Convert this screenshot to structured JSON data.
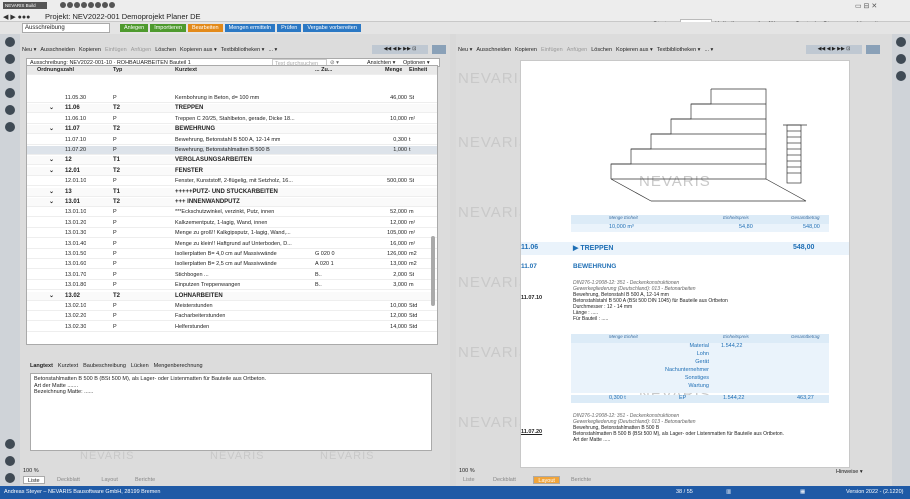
{
  "app": {
    "badge": "NEVARIS Build",
    "title": "Projekt: NEV2022-001 Demoprojekt Planer DE"
  },
  "nav_tabs": [
    "Starten",
    "Planen",
    "Kalkulieren",
    "Ausführen",
    "Control",
    "Steuern",
    "Verwalten"
  ],
  "active_nav": "Planen",
  "ribbon": {
    "left_label": "Ausschreibung",
    "actions": [
      {
        "label": "Anlegen",
        "color": "#4e9a2e"
      },
      {
        "label": "Importieren",
        "color": "#4e9a2e"
      },
      {
        "label": "Bearbeiten",
        "color": "#e38a1a"
      },
      {
        "label": "Mengen ermitteln",
        "color": "#2b78c4"
      },
      {
        "label": "Prüfen",
        "color": "#2b78c4"
      },
      {
        "label": "Vergabe vorbereiten",
        "color": "#2b78c4"
      }
    ]
  },
  "left_toolbar": [
    "Neu ▾",
    "Ausschneiden",
    "Kopieren",
    "Einfügen",
    "Anfügen",
    "Löschen",
    "Kopieren aus ▾",
    "Textbibliotheken ▾",
    "... ▾"
  ],
  "left_toolbar_disabled": [
    "Einfügen",
    "Anfügen"
  ],
  "grid": {
    "title": "Ausschreibung: NEV2022-001-10 · ROHBAUARBEITEN Bauteil 1",
    "filter_placeholder": "Text durchsuchen",
    "views": "Ansichten ▾",
    "options": "Optionen ▾",
    "headers": [
      "Ordnungszahl",
      "Typ",
      "Kurztext",
      "... Zu...",
      "Menge",
      "Einheit"
    ],
    "rows": [
      {
        "oz": "11.05.30",
        "typ": "P",
        "text": "Kernbohrung in Beton, d= 100 mm",
        "zu": "",
        "menge": "46,000",
        "einheit": "St",
        "level": "pos"
      },
      {
        "oz": "11.06",
        "typ": "T2",
        "text": "TREPPEN",
        "zu": "",
        "menge": "",
        "einheit": "",
        "level": "t2"
      },
      {
        "oz": "11.06.10",
        "typ": "P",
        "text": "Treppen C 20/25, Stahlbeton, gerade, Dicke 18...",
        "zu": "",
        "menge": "10,000",
        "einheit": "m³",
        "level": "pos"
      },
      {
        "oz": "11.07",
        "typ": "T2",
        "text": "BEWEHRUNG",
        "zu": "",
        "menge": "",
        "einheit": "",
        "level": "t2"
      },
      {
        "oz": "11.07.10",
        "typ": "P",
        "text": "Bewehrung, Betonstahl B 500 A, 12-14 mm",
        "zu": "",
        "menge": "0,300",
        "einheit": "t",
        "level": "pos"
      },
      {
        "oz": "11.07.20",
        "typ": "P",
        "text": "Bewehrung, Betonstahlmatten B 500 B",
        "zu": "",
        "menge": "1,000",
        "einheit": "t",
        "level": "sel"
      },
      {
        "oz": "12",
        "typ": "T1",
        "text": "VERGLASUNGSARBEITEN",
        "zu": "",
        "menge": "",
        "einheit": "",
        "level": "t1"
      },
      {
        "oz": "12.01",
        "typ": "T2",
        "text": "FENSTER",
        "zu": "",
        "menge": "",
        "einheit": "",
        "level": "t2"
      },
      {
        "oz": "12.01.10",
        "typ": "P",
        "text": "Fenster, Kunststoff, 2-flügelig, mit Setzholz, 16...",
        "zu": "",
        "menge": "500,000",
        "einheit": "St",
        "level": "pos"
      },
      {
        "oz": "13",
        "typ": "T1",
        "text": "+++++PUTZ- UND STUCKARBEITEN",
        "zu": "",
        "menge": "",
        "einheit": "",
        "level": "t1"
      },
      {
        "oz": "13.01",
        "typ": "T2",
        "text": "+++ INNENWANDPUTZ",
        "zu": "",
        "menge": "",
        "einheit": "",
        "level": "t2"
      },
      {
        "oz": "13.01.10",
        "typ": "P",
        "text": "***Eckschutzwinkel, verzinkt, Putz, innen",
        "zu": "",
        "menge": "52,000",
        "einheit": "m",
        "level": "pos"
      },
      {
        "oz": "13.01.20",
        "typ": "P",
        "text": "Kalkzementputz, 1-lagig, Wand, innen",
        "zu": "",
        "menge": "12,000",
        "einheit": "m²",
        "level": "pos"
      },
      {
        "oz": "13.01.30",
        "typ": "P",
        "text": "Menge zu groß!! Kalkgipsputz, 1-lagig, Wand,...",
        "zu": "",
        "menge": "105,000",
        "einheit": "m²",
        "level": "pos"
      },
      {
        "oz": "13.01.40",
        "typ": "P",
        "text": "Menge zu klein!! Haftgrund auf Unterboden, D...",
        "zu": "",
        "menge": "16,000",
        "einheit": "m²",
        "level": "pos"
      },
      {
        "oz": "13.01.50",
        "typ": "P",
        "text": "Isolierplatten B= 4,0 cm auf Massivwände",
        "zu": "G 020 0",
        "menge": "126,000",
        "einheit": "m2",
        "level": "pos"
      },
      {
        "oz": "13.01.60",
        "typ": "P",
        "text": "Isolierplatten B= 2,5 cm auf Massivwände",
        "zu": "A 020 1",
        "menge": "13,000",
        "einheit": "m2",
        "level": "pos"
      },
      {
        "oz": "13.01.70",
        "typ": "P",
        "text": "Stichbogen ...",
        "zu": "B..",
        "menge": "2,000",
        "einheit": "St",
        "level": "pos"
      },
      {
        "oz": "13.01.80",
        "typ": "P",
        "text": "Einputzen Treppenwangen",
        "zu": "B..",
        "menge": "3,000",
        "einheit": "m",
        "level": "pos"
      },
      {
        "oz": "13.02",
        "typ": "T2",
        "text": "LOHNARBEITEN",
        "zu": "",
        "menge": "",
        "einheit": "",
        "level": "t2"
      },
      {
        "oz": "13.02.10",
        "typ": "P",
        "text": "Meisterstunden",
        "zu": "",
        "menge": "10,000",
        "einheit": "Std",
        "level": "pos"
      },
      {
        "oz": "13.02.20",
        "typ": "P",
        "text": "Facharbeiterstunden",
        "zu": "",
        "menge": "12,000",
        "einheit": "Std",
        "level": "pos"
      },
      {
        "oz": "13.02.30",
        "typ": "P",
        "text": "Helferstunden",
        "zu": "",
        "menge": "14,000",
        "einheit": "Std",
        "level": "pos"
      }
    ]
  },
  "detail_tabs": [
    "Langtext",
    "Kurztext",
    "Baubeschreibung",
    "Lücken",
    "Mengenberechnung"
  ],
  "detail_lines": [
    "Betonstahlmatten B 500 B (BSt 500 M), als Lager- oder Listenmatten für Bauteile aus Ortbeton.",
    "Art der Matte .......",
    "Bezeichnung Matte: ......"
  ],
  "left_bottom": {
    "zoom": "100 %",
    "tabs": [
      "Liste",
      "Deckblatt",
      "Layout",
      "Berichte"
    ],
    "active": "Liste"
  },
  "right_toolbar": [
    "Neu ▾",
    "Ausschneiden",
    "Kopieren",
    "Einfügen",
    "Anfügen",
    "Löschen",
    "Kopieren aus ▾",
    "Textbibliotheken ▾",
    "... ▾"
  ],
  "preview": {
    "watermark": "NEVARIS",
    "price_head": [
      "Menge Einheit",
      "Einheitspreis",
      "Gesamtbetrag"
    ],
    "price_row": [
      "10,000 m³",
      "54,80",
      "548,00"
    ],
    "treppen": {
      "oz": "11.06",
      "title": "▶ TREPPEN",
      "total": "548,00"
    },
    "bewehrung": {
      "oz": "11.07",
      "title": "BEWEHRUNG"
    },
    "pos1": {
      "oz": "11.07.10",
      "norm": "DIN276-1:2008-12: 351 - Deckenkonstruktionen",
      "gewerk": "Gewerkegliederung (Deutschland): 013 - Betonarbeiten",
      "lines": [
        "Bewehrung, Betonstahl B 500 A, 12-14 mm",
        "Betonstahlstahl B 500 A (BSt 500 DIN 1045) für Bauteile aus Ortbeton",
        "Durchmesser : 12 - 14 mm",
        "Länge : .....",
        "Für Bauteil : ....."
      ]
    },
    "cost_labels": [
      "Material",
      "Lohn",
      "Gerät",
      "Nachunternehmer",
      "Sonstiges",
      "Wartung"
    ],
    "material_value": "1.544,22",
    "total_row": [
      "0,300 t",
      "EP",
      "1.544,22",
      "463,27"
    ],
    "pos2": {
      "oz": "11.07.20",
      "norm": "DIN276-1:2008-12: 351 - Deckenkonstruktionen",
      "gewerk": "Gewerkegliederung (Deutschland): 013 - Betonarbeiten",
      "lines": [
        "Bewehrung, Betonstahlmatten B 500 B",
        "Betonstahlmatten B 500 B (BSt 500 M), als Lager- oder Listenmatten für Bauteile aus Ortbeton.",
        "Art der Matte ....."
      ]
    }
  },
  "right_bottom": {
    "zoom": "100 %",
    "tabs": [
      "Liste",
      "Deckblatt",
      "Layout",
      "Berichte"
    ],
    "active": "Layout",
    "page": "38 / 55",
    "hint": "Hinweise ▾"
  },
  "status": {
    "left": "Andreas Steyer – NEVARIS Bausoftware GmbH, 28199 Bremen",
    "right": "Version 2022 - (2.1220)"
  }
}
